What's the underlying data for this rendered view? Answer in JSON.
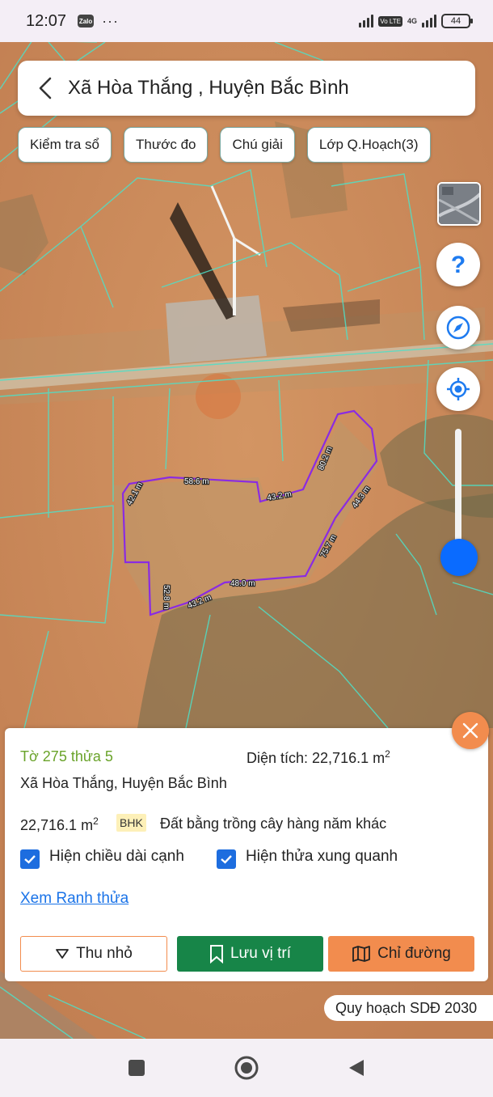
{
  "status": {
    "time": "12:07",
    "app_badge": "Zalo",
    "dots": "···",
    "lte": "Vo LTE",
    "net": "4G",
    "battery": "44"
  },
  "header": {
    "title": "Xã Hòa Thắng , Huyện Bắc Bình"
  },
  "chips": [
    {
      "label": "Kiểm tra sổ"
    },
    {
      "label": "Thước đo"
    },
    {
      "label": "Chú giải"
    },
    {
      "label": "Lớp Q.Hoạch(3)"
    }
  ],
  "map": {
    "edge_labels": [
      "58.6 m",
      "42.1 m",
      "43.2 m",
      "80.2 m",
      "44.3 m",
      "75.7 m",
      "48.0 m",
      "43.2 m",
      "52.8 m"
    ],
    "parcel_color": "#8a2be2",
    "boundary_color": "#4ee0c8"
  },
  "parcel": {
    "sheet": "Tờ 275 thửa 5",
    "area_label": "Diện tích: 22,716.1 m",
    "area_exp": "2",
    "commune": "Xã Hòa Thắng, Huyện Bắc Bình",
    "size": "22,716.1 m",
    "size_exp": "2",
    "land_code": "BHK",
    "land_desc": "Đất bằng trồng cây hàng năm khác",
    "check_edges": "Hiện chiều dài cạnh",
    "check_neighbors": "Hiện thửa xung quanh",
    "view_link": "Xem Ranh thửa"
  },
  "buttons": {
    "shrink": "Thu nhỏ",
    "save": "Lưu vị trí",
    "route": "Chỉ đường"
  },
  "plan_tag": "Quy hoạch SDĐ 2030",
  "colors": {
    "accent_green": "#178548",
    "accent_orange": "#f28c4e",
    "link_blue": "#1a73e8",
    "sheet_green": "#6aa32a"
  }
}
